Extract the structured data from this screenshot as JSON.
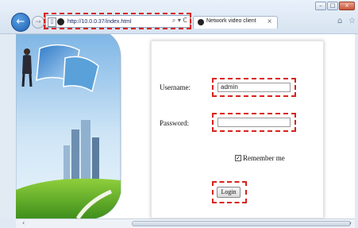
{
  "browser": {
    "address_url": "http://10.0.0.37/index.html",
    "address_tools": "⌕ ▾ C",
    "tab_title": "Network video client",
    "tab_close": "×",
    "back_glyph": "←",
    "forward_glyph": "→",
    "home_glyph": "⌂",
    "star_glyph": "☆",
    "window_buttons": [
      "–",
      "□",
      "×"
    ]
  },
  "login": {
    "username_label": "Username:",
    "username_value": "admin",
    "password_label": "Password:",
    "password_value": "",
    "remember_label": "Remember me",
    "remember_checked": true,
    "login_button": "Login"
  },
  "scrollbar": {
    "left_arrow": "‹",
    "right_arrow": "›"
  },
  "colors": {
    "highlight": "#d9231c",
    "accent": "#1f5fb0"
  },
  "icons": [
    "back-icon",
    "forward-icon",
    "page-icon",
    "search-icon",
    "refresh-icon",
    "home-icon",
    "favorites-star-icon",
    "checkbox-icon"
  ]
}
